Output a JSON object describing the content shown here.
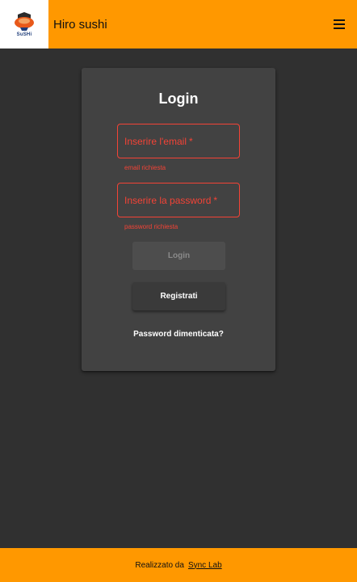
{
  "header": {
    "app_title": "Hiro sushi",
    "logo_text": "SuSHi",
    "menu_icon": "hamburger-menu-icon"
  },
  "login": {
    "title": "Login",
    "email": {
      "placeholder": "Inserire l'email",
      "required_marker": "*",
      "error": "email richiesta"
    },
    "password": {
      "placeholder": "Inserire la password",
      "required_marker": "*",
      "error": "password richiesta"
    },
    "login_button": "Login",
    "register_button": "Registrati",
    "forgot_password": "Password dimenticata?"
  },
  "footer": {
    "text": "Realizzato da",
    "link": "Sync Lab"
  },
  "colors": {
    "accent": "#ff9800",
    "background": "#303030",
    "card": "#424242",
    "error": "#f44336"
  }
}
